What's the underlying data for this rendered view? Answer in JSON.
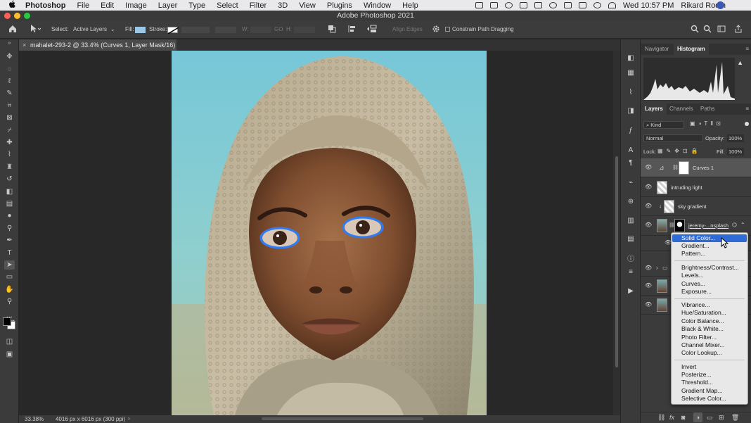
{
  "menubar": {
    "apple": "",
    "items": [
      "Photoshop",
      "File",
      "Edit",
      "Image",
      "Layer",
      "Type",
      "Select",
      "Filter",
      "3D",
      "View",
      "Plugins",
      "Window",
      "Help"
    ],
    "datetime": "Wed 10:57 PM",
    "user": "Rikard Rodin"
  },
  "window": {
    "title": "Adobe Photoshop 2021"
  },
  "options": {
    "select_label": "Select:",
    "select_value": "Active Layers",
    "fill_label": "Fill:",
    "fill_color": "#9cc8e6",
    "stroke_label": "Stroke:",
    "w_label": "W:",
    "go_label": "GO",
    "h_label": "H:",
    "align_edges": "Align Edges",
    "constrain": "Constrain Path Dragging"
  },
  "document": {
    "tab_title": "mahalet-293-2 @ 33.4% (Curves 1, Layer Mask/16) *",
    "zoom": "33.38%",
    "info": "4016 px x 6016 px (300 ppi)"
  },
  "top_panel": {
    "tabs": [
      "Navigator",
      "Histogram"
    ],
    "active": "Histogram"
  },
  "layers_panel": {
    "tabs": [
      "Layers",
      "Channels",
      "Paths"
    ],
    "active": "Layers",
    "kind_label": "Kind",
    "blend_mode": "Normal",
    "opacity_label": "Opacity:",
    "opacity_value": "100%",
    "lock_label": "Lock:",
    "fill_label": "Fill:",
    "fill_value": "100%",
    "layers": [
      {
        "name": "Curves 1",
        "selected": true
      },
      {
        "name": "intruding light",
        "selected": false
      },
      {
        "name": "sky gradient",
        "selected": false
      },
      {
        "name": "jeremy-...nsplash",
        "selected": false
      }
    ]
  },
  "context_menu": {
    "groups": [
      [
        "Solid Color...",
        "Gradient...",
        "Pattern..."
      ],
      [
        "Brightness/Contrast...",
        "Levels...",
        "Curves...",
        "Exposure..."
      ],
      [
        "Vibrance...",
        "Hue/Saturation...",
        "Color Balance...",
        "Black & White...",
        "Photo Filter...",
        "Channel Mixer...",
        "Color Lookup..."
      ],
      [
        "Invert",
        "Posterize...",
        "Threshold...",
        "Gradient Map...",
        "Selective Color..."
      ]
    ],
    "highlighted": "Solid Color..."
  },
  "colors": {
    "accent": "#2f6bd7",
    "canvas_bg": "#282828",
    "panel_bg": "#3b3b3b"
  }
}
